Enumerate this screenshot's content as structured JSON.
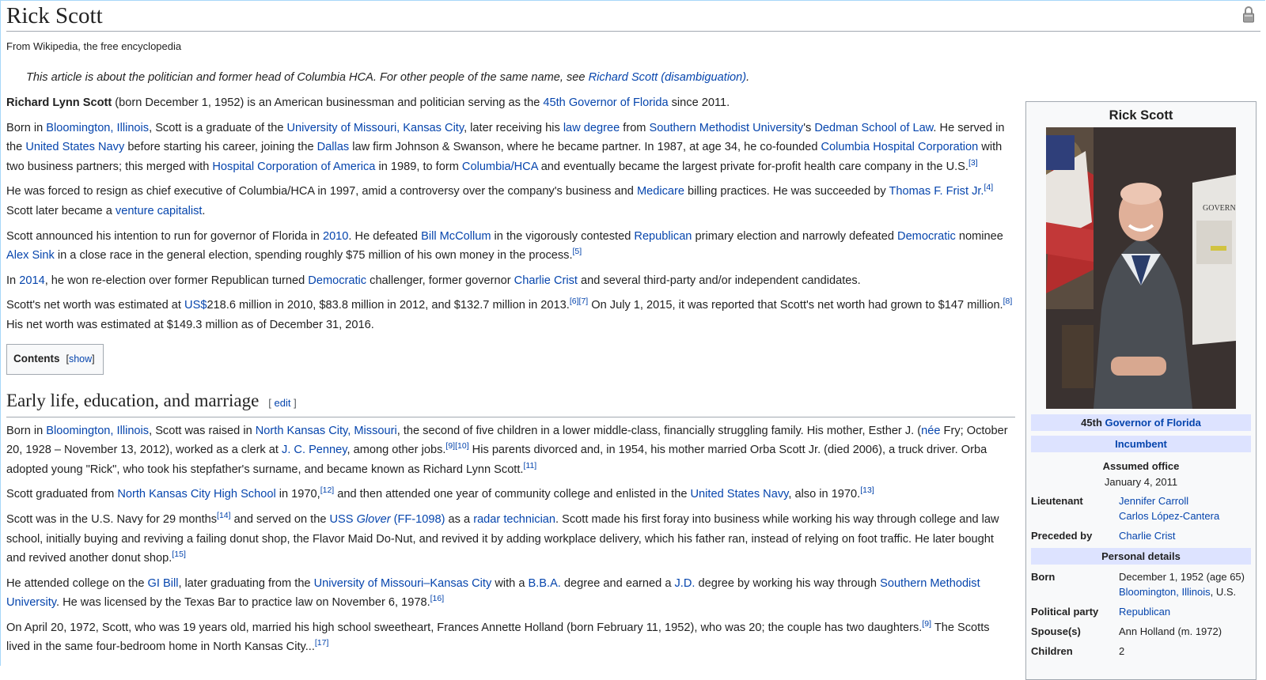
{
  "title": "Rick Scott",
  "tagline": "From Wikipedia, the free encyclopedia",
  "hatnote": {
    "text": "This article is about the politician and former head of Columbia HCA. For other people of the same name, see ",
    "link": "Richard Scott (disambiguation)",
    "end": "."
  },
  "intro": {
    "p1": {
      "bold": "Richard Lynn Scott",
      "t1": " (born December 1, 1952) is an American businessman and politician serving as the ",
      "l1": "45th Governor of Florida",
      "t2": " since 2011."
    },
    "p2": {
      "t0": "Born in ",
      "l1": "Bloomington, Illinois",
      "t1": ", Scott is a graduate of the ",
      "l2": "University of Missouri, Kansas City",
      "t2": ", later receiving his ",
      "l3": "law degree",
      "t3": " from ",
      "l4": "Southern Methodist University",
      "t4": "'s ",
      "l5": "Dedman School of Law",
      "t5": ". He served in the ",
      "l6": "United States Navy",
      "t6": " before starting his career, joining the ",
      "l7": "Dallas",
      "t7": " law firm Johnson & Swanson, where he became partner. In 1987, at age 34, he co-founded ",
      "l8": "Columbia Hospital Corporation",
      "t8": " with two business partners; this merged with ",
      "l9": "Hospital Corporation of America",
      "t9": " in 1989, to form ",
      "l10": "Columbia/HCA",
      "t10": " and eventually became the largest private for-profit health care company in the U.S.",
      "ref": "[3]"
    },
    "p3": {
      "t0": "He was forced to resign as chief executive of Columbia/HCA in 1997, amid a controversy over the company's business and ",
      "l1": "Medicare",
      "t1": " billing practices. He was succeeded by ",
      "l2": "Thomas F. Frist Jr.",
      "ref": "[4]",
      "t2": " Scott later became a ",
      "l3": "venture capitalist",
      "t3": "."
    },
    "p4": {
      "t0": "Scott announced his intention to run for governor of Florida in ",
      "l1": "2010",
      "t1": ". He defeated ",
      "l2": "Bill McCollum",
      "t2": " in the vigorously contested ",
      "l3": "Republican",
      "t3": " primary election and narrowly defeated ",
      "l4": "Democratic",
      "t4": " nominee ",
      "l5": "Alex Sink",
      "t5": " in a close race in the general election, spending roughly $75 million of his own money in the process.",
      "ref": "[5]"
    },
    "p5": {
      "t0": "In ",
      "l1": "2014",
      "t1": ", he won re-election over former Republican turned ",
      "l2": "Democratic",
      "t2": " challenger, former governor ",
      "l3": "Charlie Crist",
      "t3": " and several third-party and/or independent candidates."
    },
    "p6": {
      "t0": "Scott's net worth was estimated at ",
      "l1": "US$",
      "t1": "218.6 million in 2010, $83.8 million in 2012, and $132.7 million in 2013.",
      "ref1": "[6]",
      "ref2": "[7]",
      "t2": " On July 1, 2015, it was reported that Scott's net worth had grown to $147 million.",
      "ref3": "[8]",
      "t3": " His net worth was estimated at $149.3 million as of December 31, 2016."
    }
  },
  "toc": {
    "label": "Contents",
    "open": "[",
    "show": "show",
    "close": "]"
  },
  "section1": {
    "heading": "Early life, education, and marriage",
    "edit_open": "[ ",
    "edit": "edit",
    "edit_close": " ]",
    "p1": {
      "t0": "Born in ",
      "l1": "Bloomington, Illinois",
      "t1": ", Scott was raised in ",
      "l2": "North Kansas City, Missouri",
      "t2": ", the second of five children in a lower middle-class, financially struggling family. His mother, Esther J. (",
      "l3": "née",
      "t3": " Fry; October 20, 1928 – November 13, 2012), worked as a clerk at ",
      "l4": "J. C. Penney",
      "t4": ", among other jobs.",
      "ref1": "[9]",
      "ref2": "[10]",
      "t5": " His parents divorced and, in 1954, his mother married Orba Scott Jr. (died 2006), a truck driver. Orba adopted young \"Rick\", who took his stepfather's surname, and became known as Richard Lynn Scott.",
      "ref3": "[11]"
    },
    "p2": {
      "t0": "Scott graduated from ",
      "l1": "North Kansas City High School",
      "t1": " in 1970,",
      "ref1": "[12]",
      "t2": " and then attended one year of community college and enlisted in the ",
      "l2": "United States Navy",
      "t3": ", also in 1970.",
      "ref2": "[13]"
    },
    "p3": {
      "t0": "Scott was in the U.S. Navy for 29 months",
      "ref1": "[14]",
      "t1": " and served on the ",
      "l1a": "USS ",
      "l1b": "Glover",
      "l1c": " (FF-1098)",
      "t2": " as a ",
      "l2": "radar technician",
      "t3": ". Scott made his first foray into business while working his way through college and law school, initially buying and reviving a failing donut shop, the Flavor Maid Do-Nut, and revived it by adding workplace delivery, which his father ran, instead of relying on foot traffic. He later bought and revived another donut shop.",
      "ref2": "[15]"
    },
    "p4": {
      "t0": "He attended college on the ",
      "l1": "GI Bill",
      "t1": ", later graduating from the ",
      "l2": "University of Missouri–Kansas City",
      "t2": " with a ",
      "l3": "B.B.A.",
      "t3": " degree and earned a ",
      "l4": "J.D.",
      "t4": " degree by working his way through ",
      "l5": "Southern Methodist University",
      "t5": ". He was licensed by the Texas Bar to practice law on November 6, 1978.",
      "ref": "[16]"
    },
    "p5": {
      "t0": "On April 20, 1972, Scott, who was 19 years old, married his high school sweetheart, Frances Annette Holland (born February 11, 1952), who was 20; the couple has two daughters.",
      "ref": "[9]",
      "t1": " The Scotts lived in the same four-bedroom home in North Kansas City...",
      "ref2": "[17]"
    }
  },
  "infobox": {
    "title": "Rick Scott",
    "band1_a": "45th ",
    "band1_link": "Governor of Florida",
    "band2": "Incumbent",
    "assumed_label": "Assumed office",
    "assumed_value": "January 4, 2011",
    "rows": [
      {
        "label": "Lieutenant",
        "values": [
          "Jennifer Carroll",
          "Carlos López-Cantera"
        ]
      },
      {
        "label": "Preceded by",
        "values": [
          "Charlie Crist"
        ]
      }
    ],
    "personal_band": "Personal details",
    "born_label": "Born",
    "born_value": "December 1, 1952 (age 65)",
    "born_place_link": "Bloomington, Illinois",
    "born_place_rest": ", U.S.",
    "party_label": "Political party",
    "party_value": "Republican",
    "spouse_label": "Spouse(s)",
    "spouse_value": "Ann Holland (m. 1972)",
    "children_label": "Children",
    "children_value": "2"
  }
}
